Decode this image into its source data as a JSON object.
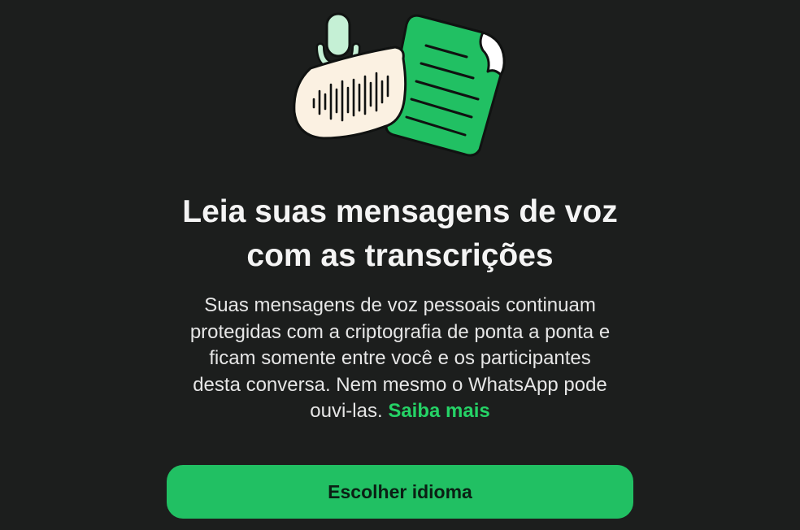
{
  "colors": {
    "background": "#1c1e1d",
    "accent": "#25d366",
    "button": "#21c063",
    "bubble": "#fbf1e2",
    "document": "#21c063",
    "mic": "#c5f0d5"
  },
  "illustration": {
    "icons": [
      "microphone-icon",
      "voice-bubble-icon",
      "document-icon"
    ]
  },
  "title": {
    "line1": "Leia suas mensagens de voz",
    "line2": "com as transcrições"
  },
  "body": {
    "lines": [
      "Suas mensagens de voz pessoais continuam",
      "protegidas com a criptografia de ponta a ponta e",
      "ficam somente entre você e os participantes",
      "desta conversa. Nem mesmo o WhatsApp pode"
    ],
    "last_line_prefix": "ouvi-las.",
    "learn_more": "Saiba mais"
  },
  "cta": {
    "label": "Escolher idioma"
  }
}
